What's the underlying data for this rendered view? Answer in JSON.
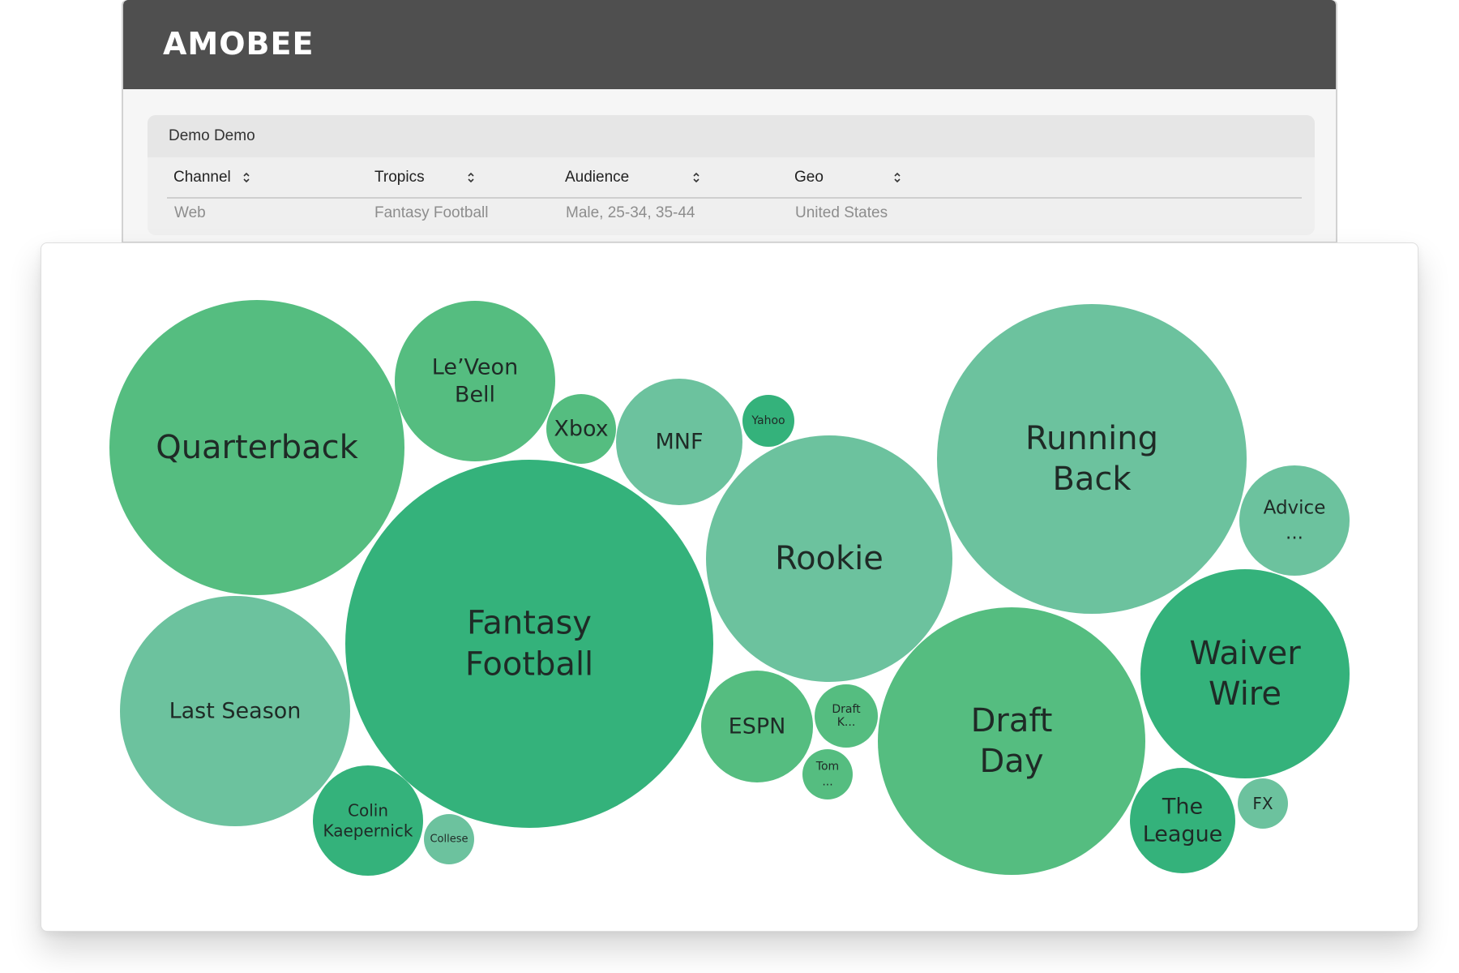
{
  "app": {
    "logo": "AMOBEE"
  },
  "query": {
    "title": "Demo Demo",
    "columns": [
      {
        "header": "Channel",
        "value": "Web"
      },
      {
        "header": "Tropics",
        "value": "Fantasy Football"
      },
      {
        "header": "Audience",
        "value": "Male, 25-34, 35-44"
      },
      {
        "header": "Geo",
        "value": "United States"
      }
    ]
  },
  "colors": {
    "dark": "#34b27b",
    "medium": "#55bd80",
    "light": "#6cc29e",
    "header": "#4f4f4f"
  },
  "chart_data": {
    "type": "bubble",
    "bubbles": [
      {
        "label": "Quarterback",
        "lines": [
          "Quarterback"
        ],
        "tone": "medium"
      },
      {
        "label": "Le'Veon Bell",
        "lines": [
          "Le’Veon",
          "Bell"
        ],
        "tone": "medium"
      },
      {
        "label": "Xbox",
        "lines": [
          "Xbox"
        ],
        "tone": "medium"
      },
      {
        "label": "MNF",
        "lines": [
          "MNF"
        ],
        "tone": "light"
      },
      {
        "label": "Yahoo",
        "lines": [
          "Yahoo"
        ],
        "tone": "dark"
      },
      {
        "label": "Running Back",
        "lines": [
          "Running",
          "Back"
        ],
        "tone": "light"
      },
      {
        "label": "Advice ...",
        "lines": [
          "Advice",
          "..."
        ],
        "tone": "light"
      },
      {
        "label": "Fantasy Football",
        "lines": [
          "Fantasy",
          "Football"
        ],
        "tone": "dark"
      },
      {
        "label": "Rookie",
        "lines": [
          "Rookie"
        ],
        "tone": "light"
      },
      {
        "label": "Last Season",
        "lines": [
          "Last Season"
        ],
        "tone": "light"
      },
      {
        "label": "Colin Kaepernick",
        "lines": [
          "Colin",
          "Kaepernick"
        ],
        "tone": "dark"
      },
      {
        "label": "Collese",
        "lines": [
          "Collese"
        ],
        "tone": "light"
      },
      {
        "label": "ESPN",
        "lines": [
          "ESPN"
        ],
        "tone": "medium"
      },
      {
        "label": "Draft K...",
        "lines": [
          "Draft",
          "K..."
        ],
        "tone": "medium"
      },
      {
        "label": "Tom ...",
        "lines": [
          "Tom",
          "..."
        ],
        "tone": "medium"
      },
      {
        "label": "Draft Day",
        "lines": [
          "Draft",
          "Day"
        ],
        "tone": "medium"
      },
      {
        "label": "Waiver Wire",
        "lines": [
          "Waiver",
          "Wire"
        ],
        "tone": "dark"
      },
      {
        "label": "The League",
        "lines": [
          "The",
          "League"
        ],
        "tone": "dark"
      },
      {
        "label": "FX",
        "lines": [
          "FX"
        ],
        "tone": "light"
      }
    ]
  }
}
